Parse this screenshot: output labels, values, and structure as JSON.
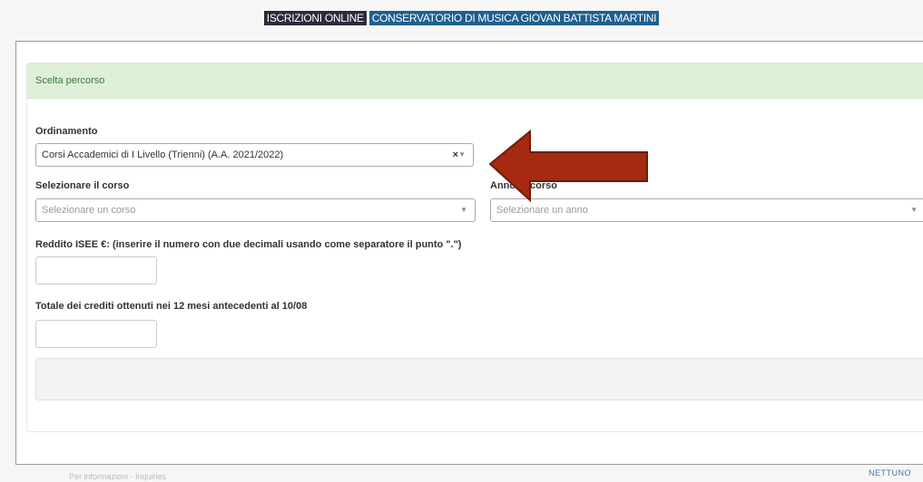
{
  "header": {
    "tag1": "ISCRIZIONI ONLINE",
    "tag2": "CONSERVATORIO DI MUSICA GIOVAN BATTISTA MARTINI"
  },
  "panel": {
    "title": "Scelta percorso"
  },
  "form": {
    "ordinamento_label": "Ordinamento",
    "ordinamento_value": "Corsi Accademici di I Livello (Trienni) (A.A. 2021/2022)",
    "ordinamento_clear": "×",
    "corso_label": "Selezionare il corso",
    "corso_placeholder": "Selezionare un corso",
    "anno_label": "Anno di corso",
    "anno_placeholder": "Selezionare un anno",
    "isee_label": "Reddito ISEE €: (inserire il numero con due decimali usando come separatore il punto \".\")",
    "isee_value": "",
    "crediti_label": "Totale dei crediti ottenuti nei 12 mesi antecedenti al 10/08",
    "crediti_value": "",
    "dropdown_arrow": "▼"
  },
  "footer": {
    "info": "Per informazioni - Inquiries",
    "brand": "NETTUNO"
  },
  "annotation": {
    "arrow_color": "#a52a10"
  }
}
